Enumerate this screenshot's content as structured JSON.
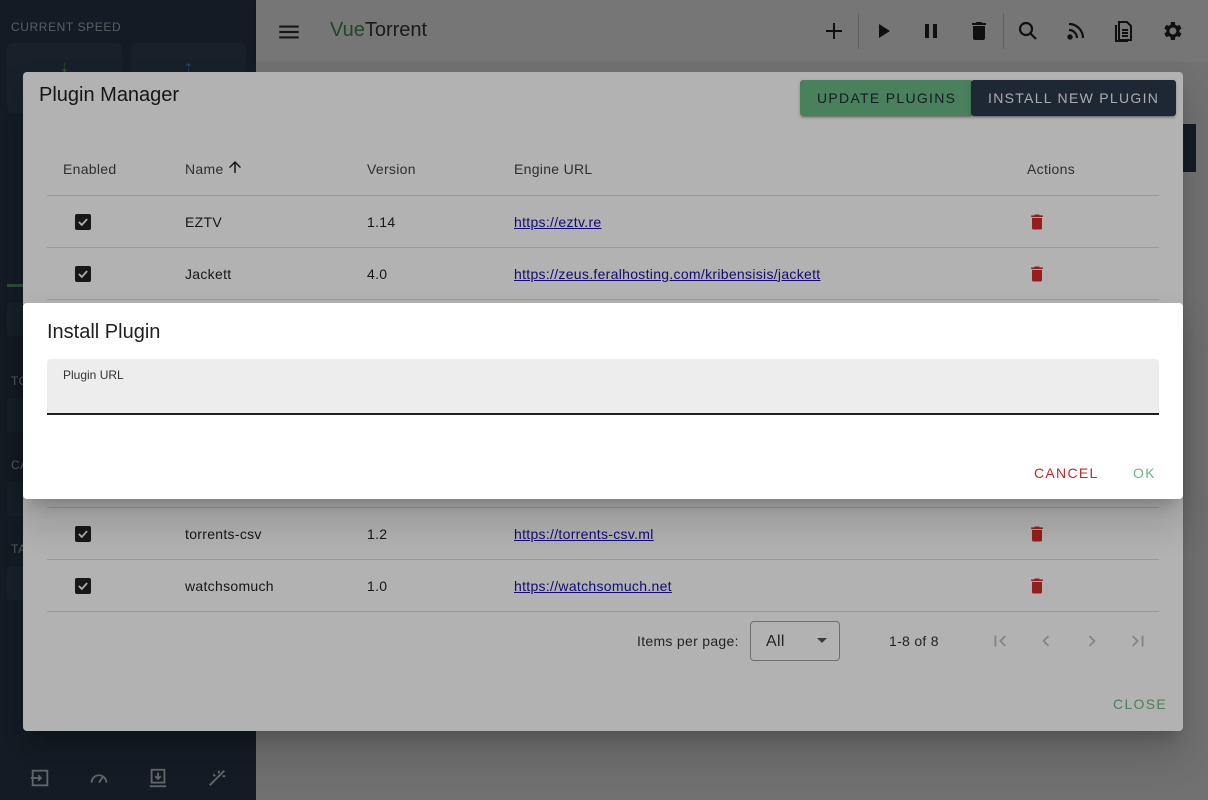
{
  "sidebar": {
    "speed_heading": "CURRENT SPEED",
    "peek_letters": [
      "TO",
      "CA",
      "TA"
    ]
  },
  "topbar": {
    "brand_prefix": "Vue",
    "brand_suffix": "Torrent"
  },
  "plugin_manager": {
    "title": "Plugin Manager",
    "update_label": "UPDATE PLUGINS",
    "install_label": "INSTALL NEW PLUGIN",
    "columns": {
      "enabled": "Enabled",
      "name": "Name",
      "version": "Version",
      "url": "Engine URL",
      "actions": "Actions"
    },
    "rows": [
      {
        "name": "EZTV",
        "version": "1.14",
        "url": "https://eztv.re",
        "enabled": true
      },
      {
        "name": "Jackett",
        "version": "4.0",
        "url": "https://zeus.feralhosting.com/kribensisis/jackett",
        "enabled": true
      },
      {
        "name": "torrents-csv",
        "version": "1.2",
        "url": "https://torrents-csv.ml",
        "enabled": true
      },
      {
        "name": "watchsomuch",
        "version": "1.0",
        "url": "https://watchsomuch.net",
        "enabled": true
      }
    ],
    "footer": {
      "items_per_page_label": "Items per page:",
      "items_per_page_value": "All",
      "page_info": "1-8 of 8"
    },
    "close_label": "CLOSE"
  },
  "install_dialog": {
    "title": "Install Plugin",
    "field_label": "Plugin URL",
    "field_value": "",
    "cancel_label": "CANCEL",
    "ok_label": "OK"
  },
  "colors": {
    "accent_green": "#68b984",
    "navy": "#2b3a4c",
    "danger_red": "#d32f2f"
  }
}
